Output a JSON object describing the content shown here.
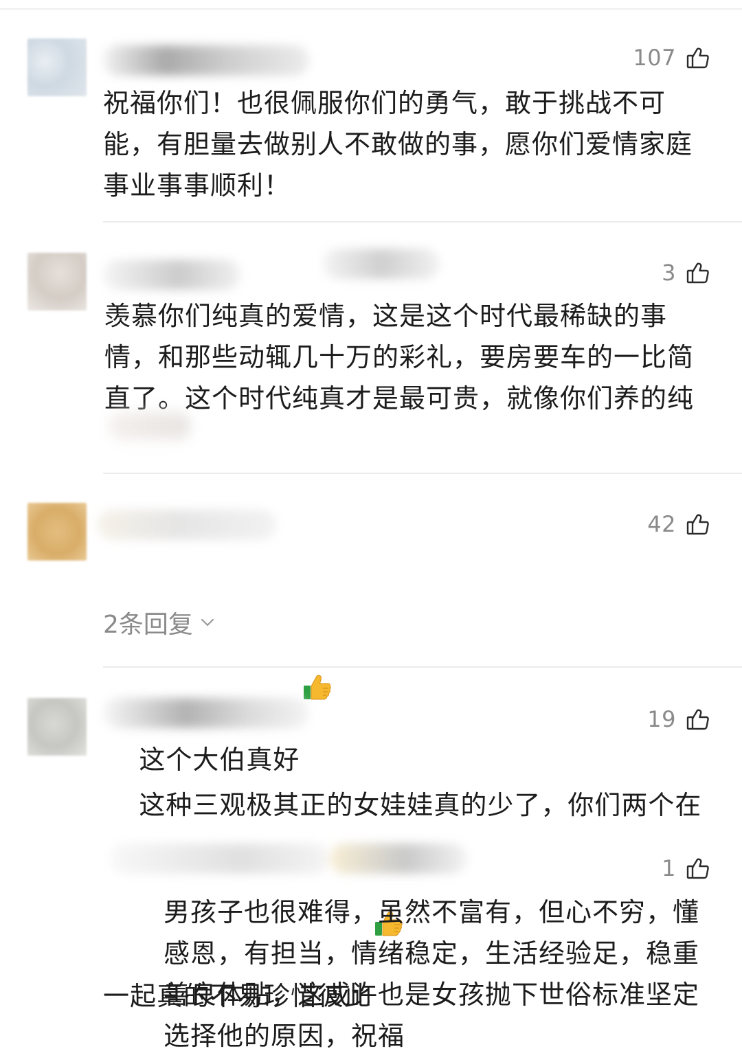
{
  "comments": [
    {
      "likes": "107",
      "text": "祝福你们！也很佩服你们的勇气，敢于挑战不可能，有胆量去做别人不敢做的事，愿你们爱情家庭事业事事顺利！"
    },
    {
      "likes": "3",
      "text": "羡慕你们纯真的爱情，这是这个时代最稀缺的事情，和那些动辄几十万的彩礼，要房要车的一比简直了。这个时代纯真才是最可贵，就像你们养的纯"
    },
    {
      "likes": "42",
      "text": "这个大伯真好",
      "reply_link": "2条回复"
    },
    {
      "likes": "19",
      "text": "这种三观极其正的女娃娃真的少了，你们两个在一起真的不易珍惜彼此",
      "reply": {
        "likes": "1",
        "text": "男孩子也很难得，虽然不富有，但心不穷，懂感恩，有担当，情绪稳定，生活经验足，稳重善良体贴，这或许也是女孩抛下世俗标准坚定选择他的原因，祝福"
      }
    }
  ],
  "icons": {
    "like": "thumb-up-outline-icon",
    "emoji": "thumbs-up-emoji-icon",
    "expand": "chevron-down-icon"
  },
  "colors": {
    "text": "#1c1c1c",
    "secondary": "#8a8a8a",
    "divider": "#ececec",
    "emoji_yellow": "#f5b82e",
    "emoji_green": "#2ea043"
  }
}
